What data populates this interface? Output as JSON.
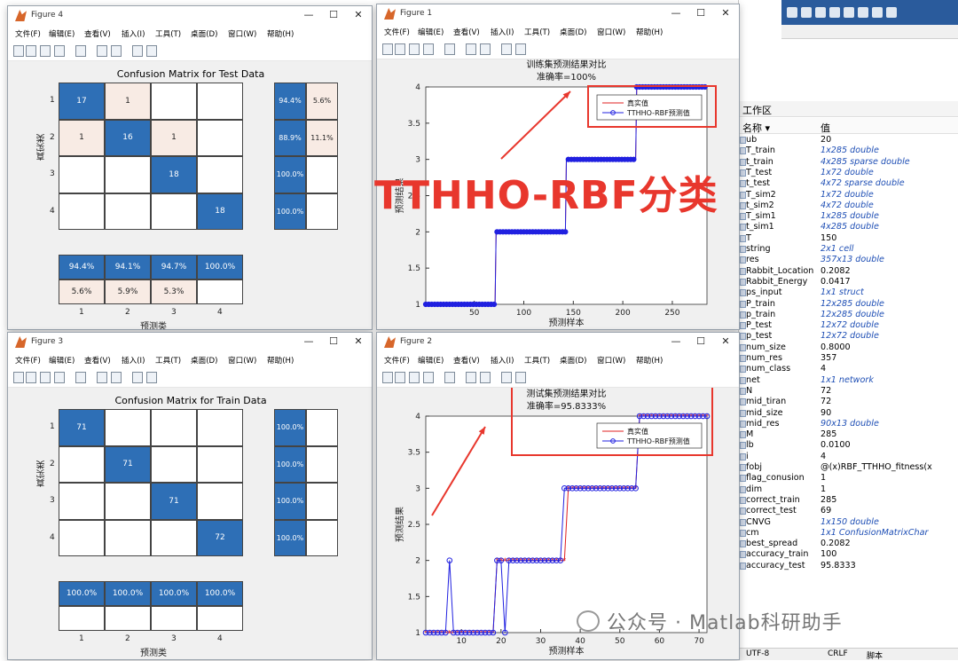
{
  "right_panel": {
    "workspace_title": "工作区",
    "col_name": "名称 ▾",
    "col_value": "值",
    "rows": [
      {
        "name": "ub",
        "value": "20",
        "italic": false
      },
      {
        "name": "T_train",
        "value": "1x285 double",
        "italic": true
      },
      {
        "name": "t_train",
        "value": "4x285 sparse double",
        "italic": true
      },
      {
        "name": "T_test",
        "value": "1x72 double",
        "italic": true
      },
      {
        "name": "t_test",
        "value": "4x72 sparse double",
        "italic": true
      },
      {
        "name": "T_sim2",
        "value": "1x72 double",
        "italic": true
      },
      {
        "name": "t_sim2",
        "value": "4x72 double",
        "italic": true
      },
      {
        "name": "T_sim1",
        "value": "1x285 double",
        "italic": true
      },
      {
        "name": "t_sim1",
        "value": "4x285 double",
        "italic": true
      },
      {
        "name": "T",
        "value": "150",
        "italic": false
      },
      {
        "name": "string",
        "value": "2x1 cell",
        "italic": true
      },
      {
        "name": "res",
        "value": "357x13 double",
        "italic": true
      },
      {
        "name": "Rabbit_Location",
        "value": "0.2082",
        "italic": false
      },
      {
        "name": "Rabbit_Energy",
        "value": "0.0417",
        "italic": false
      },
      {
        "name": "ps_input",
        "value": "1x1 struct",
        "italic": true
      },
      {
        "name": "P_train",
        "value": "12x285 double",
        "italic": true
      },
      {
        "name": "p_train",
        "value": "12x285 double",
        "italic": true
      },
      {
        "name": "P_test",
        "value": "12x72 double",
        "italic": true
      },
      {
        "name": "p_test",
        "value": "12x72 double",
        "italic": true
      },
      {
        "name": "num_size",
        "value": "0.8000",
        "italic": false
      },
      {
        "name": "num_res",
        "value": "357",
        "italic": false
      },
      {
        "name": "num_class",
        "value": "4",
        "italic": false
      },
      {
        "name": "net",
        "value": "1x1 network",
        "italic": true
      },
      {
        "name": "N",
        "value": "72",
        "italic": false
      },
      {
        "name": "mid_tiran",
        "value": "72",
        "italic": false
      },
      {
        "name": "mid_size",
        "value": "90",
        "italic": false
      },
      {
        "name": "mid_res",
        "value": "90x13 double",
        "italic": true
      },
      {
        "name": "M",
        "value": "285",
        "italic": false
      },
      {
        "name": "lb",
        "value": "0.0100",
        "italic": false
      },
      {
        "name": "i",
        "value": "4",
        "italic": false
      },
      {
        "name": "fobj",
        "value": "@(x)RBF_TTHHO_fitness(x",
        "italic": false
      },
      {
        "name": "flag_conusion",
        "value": "1",
        "italic": false
      },
      {
        "name": "dim",
        "value": "1",
        "italic": false
      },
      {
        "name": "correct_train",
        "value": "285",
        "italic": false
      },
      {
        "name": "correct_test",
        "value": "69",
        "italic": false
      },
      {
        "name": "CNVG",
        "value": "1x150 double",
        "italic": true
      },
      {
        "name": "cm",
        "value": "1x1 ConfusionMatrixChar",
        "italic": true
      },
      {
        "name": "best_spread",
        "value": "0.2082",
        "italic": false
      },
      {
        "name": "accuracy_train",
        "value": "100",
        "italic": false
      },
      {
        "name": "accuracy_test",
        "value": "95.8333",
        "italic": false
      }
    ],
    "status_encoding": "UTF-8",
    "status_eol": "CRLF",
    "status_script": "脚本"
  },
  "menu_items": [
    "文件(F)",
    "编辑(E)",
    "查看(V)",
    "插入(I)",
    "工具(T)",
    "桌面(D)",
    "窗口(W)",
    "帮助(H)"
  ],
  "window_controls": {
    "min": "—",
    "max": "☐",
    "close": "✕"
  },
  "fig4": {
    "title": "Figure 4",
    "chart_title": "Confusion Matrix for Test Data",
    "matrix": [
      [
        "17",
        "1",
        "",
        ""
      ],
      [
        "1",
        "16",
        "1",
        ""
      ],
      [
        "",
        "",
        "18",
        ""
      ],
      [
        "",
        "",
        "",
        "18"
      ]
    ],
    "row_summary": [
      [
        "94.4%",
        "5.6%"
      ],
      [
        "88.9%",
        "11.1%"
      ],
      [
        "100.0%",
        ""
      ],
      [
        "100.0%",
        ""
      ]
    ],
    "col_summary": [
      [
        "94.4%",
        "94.1%",
        "94.7%",
        "100.0%"
      ],
      [
        "5.6%",
        "5.9%",
        "5.3%",
        ""
      ]
    ],
    "row_ticks": [
      "1",
      "2",
      "3",
      "4"
    ],
    "col_ticks": [
      "1",
      "2",
      "3",
      "4"
    ],
    "ylabel": "真实类",
    "xlabel": "预测类"
  },
  "fig3": {
    "title": "Figure 3",
    "chart_title": "Confusion Matrix for Train Data",
    "matrix": [
      [
        "71",
        "",
        "",
        ""
      ],
      [
        "",
        "71",
        "",
        ""
      ],
      [
        "",
        "",
        "71",
        ""
      ],
      [
        "",
        "",
        "",
        "72"
      ]
    ],
    "row_summary": [
      [
        "100.0%",
        ""
      ],
      [
        "100.0%",
        ""
      ],
      [
        "100.0%",
        ""
      ],
      [
        "100.0%",
        ""
      ]
    ],
    "col_summary": [
      [
        "100.0%",
        "100.0%",
        "100.0%",
        "100.0%"
      ],
      [
        "",
        "",
        "",
        ""
      ]
    ],
    "row_ticks": [
      "1",
      "2",
      "3",
      "4"
    ],
    "col_ticks": [
      "1",
      "2",
      "3",
      "4"
    ],
    "ylabel": "真实类",
    "xlabel": "预测类"
  },
  "fig1": {
    "title": "Figure 1"
  },
  "fig2": {
    "title": "Figure 2"
  },
  "chart_data": [
    {
      "type": "line",
      "title": "训练集预测结果对比",
      "subtitle": "准确率=100%",
      "xlabel": "预测样本",
      "ylabel": "预测结果",
      "xlim": [
        1,
        285
      ],
      "ylim": [
        1,
        4
      ],
      "xticks": [
        50,
        100,
        150,
        200,
        250
      ],
      "yticks": [
        1,
        1.5,
        2,
        2.5,
        3,
        3.5,
        4
      ],
      "series": [
        {
          "name": "真实值",
          "color": "#e02020",
          "marker": "*",
          "steps": [
            [
              1,
              1
            ],
            [
              72,
              2
            ],
            [
              143,
              3
            ],
            [
              214,
              4
            ],
            [
              285,
              4
            ]
          ]
        },
        {
          "name": "TTHHO-RBF预测值",
          "color": "#2020e0",
          "marker": "o",
          "steps": [
            [
              1,
              1
            ],
            [
              72,
              2
            ],
            [
              143,
              3
            ],
            [
              214,
              4
            ],
            [
              285,
              4
            ]
          ]
        }
      ]
    },
    {
      "type": "line",
      "title": "测试集预测结果对比",
      "subtitle": "准确率=95.8333%",
      "xlabel": "预测样本",
      "ylabel": "预测结果",
      "xlim": [
        1,
        72
      ],
      "ylim": [
        1,
        4
      ],
      "xticks": [
        10,
        20,
        30,
        40,
        50,
        60,
        70
      ],
      "yticks": [
        1,
        1.5,
        2,
        2.5,
        3,
        3.5,
        4
      ],
      "series": [
        {
          "name": "真实值",
          "color": "#e02020",
          "marker": "*",
          "values": [
            1,
            1,
            1,
            1,
            1,
            1,
            1,
            1,
            1,
            1,
            1,
            1,
            1,
            1,
            1,
            1,
            1,
            1,
            2,
            2,
            2,
            2,
            2,
            2,
            2,
            2,
            2,
            2,
            2,
            2,
            2,
            2,
            2,
            2,
            2,
            2,
            3,
            3,
            3,
            3,
            3,
            3,
            3,
            3,
            3,
            3,
            3,
            3,
            3,
            3,
            3,
            3,
            3,
            3,
            4,
            4,
            4,
            4,
            4,
            4,
            4,
            4,
            4,
            4,
            4,
            4,
            4,
            4,
            4,
            4,
            4,
            4
          ]
        },
        {
          "name": "TTHHO-RBF预测值",
          "color": "#2020e0",
          "marker": "o",
          "values": [
            1,
            1,
            1,
            1,
            1,
            1,
            2,
            1,
            1,
            1,
            1,
            1,
            1,
            1,
            1,
            1,
            1,
            1,
            2,
            2,
            1,
            2,
            2,
            2,
            2,
            2,
            2,
            2,
            2,
            2,
            2,
            2,
            2,
            2,
            2,
            3,
            3,
            3,
            3,
            3,
            3,
            3,
            3,
            3,
            3,
            3,
            3,
            3,
            3,
            3,
            3,
            3,
            3,
            3,
            4,
            4,
            4,
            4,
            4,
            4,
            4,
            4,
            4,
            4,
            4,
            4,
            4,
            4,
            4,
            4,
            4,
            4
          ]
        }
      ]
    }
  ],
  "overlay": {
    "headline": "TTHHO-RBF分类",
    "watermark": "公众号 · Matlab科研助手"
  }
}
